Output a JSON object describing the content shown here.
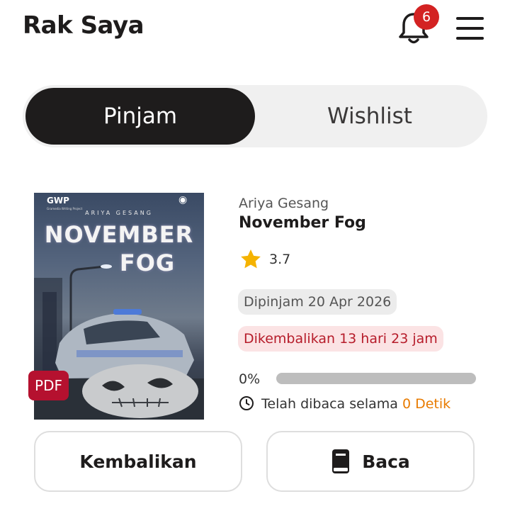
{
  "header": {
    "title": "Rak Saya",
    "notification_count": "6",
    "bell_icon": "bell-icon",
    "menu_icon": "hamburger-menu-icon"
  },
  "tabs": [
    {
      "label": "Pinjam",
      "active": true
    },
    {
      "label": "Wishlist",
      "active": false
    }
  ],
  "book": {
    "cover": {
      "publisher": "GWP",
      "publisher_sub": "Gramedia Writing Project",
      "author": "ARIYA GESANG",
      "title_line1": "NOVEMBER",
      "title_line2": "FOG"
    },
    "format_badge": "PDF",
    "author": "Ariya Gesang",
    "title": "November Fog",
    "rating": "3.7",
    "borrowed": "Dipinjam 20 Apr 2026",
    "return_due": "Dikembalikan 13 hari 23 jam",
    "progress_label": "0%",
    "progress": 0,
    "read_time_prefix": "Telah dibaca selama",
    "read_time_value": "0 Detik"
  },
  "actions": {
    "return_label": "Kembalikan",
    "read_label": "Baca"
  },
  "colors": {
    "accent_dark": "#1e1c1c",
    "badge_red": "#d32222",
    "return_text": "#b61c2a",
    "read_time_orange": "#e87b00",
    "star_yellow": "#f5b301"
  }
}
